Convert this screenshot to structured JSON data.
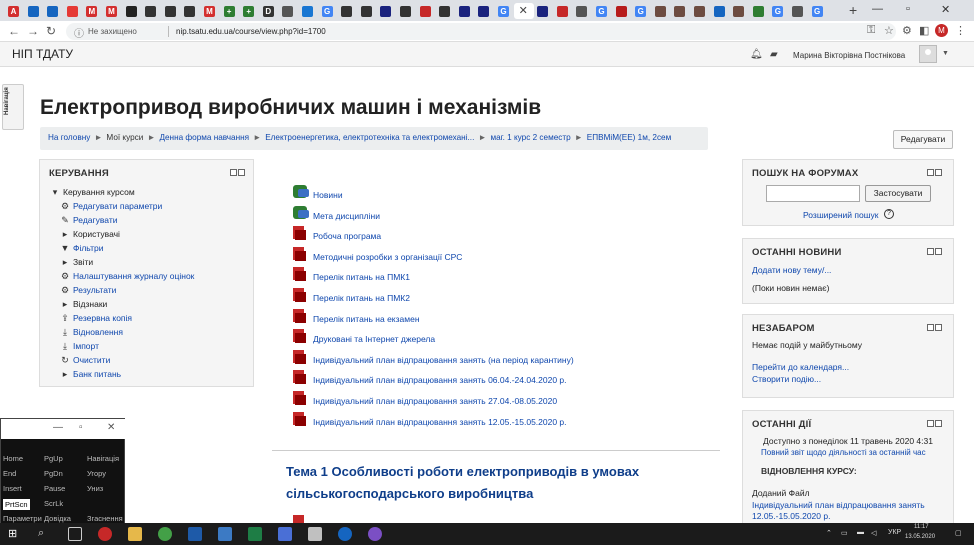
{
  "browser": {
    "tabs": [
      {
        "icon": "acrobat-icon",
        "glyph": "A",
        "color": "#d32f2f"
      },
      {
        "icon": "drop-icon",
        "glyph": "",
        "color": "#1565c0"
      },
      {
        "icon": "shield-icon",
        "glyph": "",
        "color": "#1565c0"
      },
      {
        "icon": "slash-icon",
        "glyph": "",
        "color": "#e53935"
      },
      {
        "icon": "gmail-icon",
        "glyph": "M",
        "color": "#d32f2f"
      },
      {
        "icon": "gmail-icon",
        "glyph": "M",
        "color": "#d32f2f"
      },
      {
        "icon": "circle-icon",
        "glyph": "",
        "color": "#222"
      },
      {
        "icon": "monitor-icon",
        "glyph": "",
        "color": "#333"
      },
      {
        "icon": "circle-icon",
        "glyph": "",
        "color": "#333"
      },
      {
        "icon": "circle-icon",
        "glyph": "",
        "color": "#333"
      },
      {
        "icon": "gmail-icon",
        "glyph": "M",
        "color": "#d32f2f"
      },
      {
        "icon": "plus-square-icon",
        "glyph": "+",
        "color": "#2e7d32"
      },
      {
        "icon": "plus-square-icon",
        "glyph": "+",
        "color": "#2e7d32"
      },
      {
        "icon": "doc-icon",
        "glyph": "D",
        "color": "#333"
      },
      {
        "icon": "book-icon",
        "glyph": "",
        "color": "#555"
      },
      {
        "icon": "cloud-icon",
        "glyph": "",
        "color": "#1976d2"
      },
      {
        "icon": "google-icon",
        "glyph": "G",
        "color": "#4285f4"
      },
      {
        "icon": "pin-icon",
        "glyph": "",
        "color": "#333"
      },
      {
        "icon": "circle-icon",
        "glyph": "",
        "color": "#333"
      },
      {
        "icon": "square-icon",
        "glyph": "",
        "color": "#1a237e"
      },
      {
        "icon": "circle-icon",
        "glyph": "",
        "color": "#333"
      },
      {
        "icon": "chat-icon",
        "glyph": "",
        "color": "#c62828"
      },
      {
        "icon": "circle-icon",
        "glyph": "",
        "color": "#333"
      },
      {
        "icon": "square-icon",
        "glyph": "",
        "color": "#1a237e"
      },
      {
        "icon": "square-icon",
        "glyph": "",
        "color": "#1a237e"
      },
      {
        "icon": "google-icon",
        "glyph": "G",
        "color": "#4285f4"
      },
      {
        "icon": "close-icon",
        "glyph": "",
        "color": "#fff",
        "active": true
      },
      {
        "icon": "circle-icon",
        "glyph": "",
        "color": "#1a237e"
      },
      {
        "icon": "red-circle-icon",
        "glyph": "",
        "color": "#c62828"
      },
      {
        "icon": "search-icon",
        "glyph": "",
        "color": "#555"
      },
      {
        "icon": "google-icon",
        "glyph": "G",
        "color": "#4285f4"
      },
      {
        "icon": "red-circle-icon",
        "glyph": "",
        "color": "#b71c1c"
      },
      {
        "icon": "google-icon",
        "glyph": "G",
        "color": "#4285f4"
      },
      {
        "icon": "emblem-icon",
        "glyph": "",
        "color": "#6d4c41"
      },
      {
        "icon": "emblem-icon",
        "glyph": "",
        "color": "#6d4c41"
      },
      {
        "icon": "emblem-icon",
        "glyph": "",
        "color": "#6d4c41"
      },
      {
        "icon": "ukraine-icon",
        "glyph": "",
        "color": "#1565c0"
      },
      {
        "icon": "emblem-icon",
        "glyph": "",
        "color": "#6d4c41"
      },
      {
        "icon": "green-square-icon",
        "glyph": "",
        "color": "#2e7d32"
      },
      {
        "icon": "google-icon",
        "glyph": "G",
        "color": "#4285f4"
      },
      {
        "icon": "gear-icon",
        "glyph": "",
        "color": "#555"
      },
      {
        "icon": "google-icon",
        "glyph": "G",
        "color": "#4285f4"
      }
    ],
    "new_tab": "+",
    "address": {
      "security_label": "Не захищено",
      "url": "nip.tsatu.edu.ua/course/view.php?id=1700"
    },
    "profile_letter": "M"
  },
  "navbar": {
    "brand": "НІП ТДАТУ",
    "user_name": "Марина Вікторівна Постнікова"
  },
  "drawer_label": "Навігація",
  "page": {
    "title": "Електропривод виробничих машин і механізмів",
    "edit_button": "Редагувати",
    "breadcrumb": [
      {
        "label": "На головну",
        "link": true
      },
      {
        "label": "Мої курси",
        "link": false
      },
      {
        "label": "Денна форма навчання",
        "link": true
      },
      {
        "label": "Електроенергетика, електротехніка та електромехані...",
        "link": true
      },
      {
        "label": "маг. 1 курс 2 семестр",
        "link": true
      },
      {
        "label": "ЕПВМіМ(ЕЕ) 1м, 2сем",
        "link": true
      }
    ]
  },
  "admin_block": {
    "title": "КЕРУВАННЯ",
    "items": [
      {
        "label": "Керування курсом",
        "icon": "triangle-down-icon",
        "glyph": "▾",
        "link": false
      },
      {
        "label": "Редагувати параметри",
        "icon": "gear-icon",
        "glyph": "⚙",
        "link": true
      },
      {
        "label": "Редагувати",
        "icon": "pencil-icon",
        "glyph": "✎",
        "link": true
      },
      {
        "label": "Користувачі",
        "icon": "triangle-right-icon",
        "glyph": "▸",
        "link": false
      },
      {
        "label": "Фільтри",
        "icon": "filter-icon",
        "glyph": "▼",
        "link": true
      },
      {
        "label": "Звіти",
        "icon": "triangle-right-icon",
        "glyph": "▸",
        "link": false
      },
      {
        "label": "Налаштування журналу оцінок",
        "icon": "gear-icon",
        "glyph": "⚙",
        "link": true
      },
      {
        "label": "Результати",
        "icon": "gear-icon",
        "glyph": "⚙",
        "link": true
      },
      {
        "label": "Відзнаки",
        "icon": "triangle-right-icon",
        "glyph": "▸",
        "link": false
      },
      {
        "label": "Резервна копія",
        "icon": "upload-icon",
        "glyph": "⇪",
        "link": true
      },
      {
        "label": "Відновлення",
        "icon": "download-icon",
        "glyph": "⤓",
        "link": true
      },
      {
        "label": "Імпорт",
        "icon": "download-icon",
        "glyph": "⤓",
        "link": true
      },
      {
        "label": "Очистити",
        "icon": "refresh-icon",
        "glyph": "↻",
        "link": true
      },
      {
        "label": "Банк питань",
        "icon": "triangle-right-icon",
        "glyph": "▸",
        "link": true
      }
    ]
  },
  "resources": [
    {
      "label": "Новини",
      "type": "forum"
    },
    {
      "label": "Мета дисципліни",
      "type": "forum"
    },
    {
      "label": "Робоча програма",
      "type": "pdf"
    },
    {
      "label": "Методичні розробки з організації СРС",
      "type": "pdf"
    },
    {
      "label": "Перелік питань на ПМК1",
      "type": "pdf"
    },
    {
      "label": "Перелік питань на ПМК2",
      "type": "pdf"
    },
    {
      "label": "Перелік питань на екзамен",
      "type": "pdf"
    },
    {
      "label": "Друковані та Інтернет джерела",
      "type": "pdf"
    },
    {
      "label": "Індивідуальний план відпрацювання занять (на період карантину)",
      "type": "pdf"
    },
    {
      "label": "Індивідуальний план відпрацювання занять 06.04.-24.04.2020 р.",
      "type": "pdf"
    },
    {
      "label": "Індивідуальний план відпрацювання занять 27.04.-08.05.2020",
      "type": "pdf"
    },
    {
      "label": "Індивідуальний план відпрацювання занять 12.05.-15.05.2020 р.",
      "type": "pdf"
    }
  ],
  "section1_title": "Тема 1 Особливості роботи електроприводів в умовах сільськогосподарського виробництва",
  "search_block": {
    "title": "ПОШУК НА ФОРУМАХ",
    "input_value": "",
    "button": "Застосувати",
    "advanced": "Розширений пошук"
  },
  "news_block": {
    "title": "ОСТАННІ НОВИНИ",
    "add_link": "Додати нову тему/...",
    "empty": "(Поки новин немає)"
  },
  "upcoming_block": {
    "title": "НЕЗАБАРОМ",
    "empty": "Немає подій у майбутньому",
    "calendar_link": "Перейти до календаря...",
    "new_event_link": "Створити подію..."
  },
  "activity_block": {
    "title": "ОСТАННІ ДІЇ",
    "since": "Доступно з понеділок 11 травень 2020 4:31",
    "full_report": "Повний звіт щодо діяльності за останній час",
    "section_heading": "ВІДНОВЛЕННЯ КУРСУ:",
    "added": "Доданий Файл",
    "file_link": "Індивідуальний план відпрацювання занять 12.05.-15.05.2020 р."
  },
  "keyboard_popup": {
    "keys": [
      [
        "Home",
        "PgUp",
        "Навігація"
      ],
      [
        "End",
        "PgDn",
        "Угору"
      ],
      [
        "Insert",
        "Pause",
        "Униз"
      ],
      [
        "PrtScn",
        "ScrLk",
        ""
      ],
      [
        "Параметри",
        "Довідка",
        "Згаснення"
      ]
    ]
  },
  "taskbar": {
    "lang": "УКР",
    "time": "11:17",
    "date": "13.05.2020"
  }
}
